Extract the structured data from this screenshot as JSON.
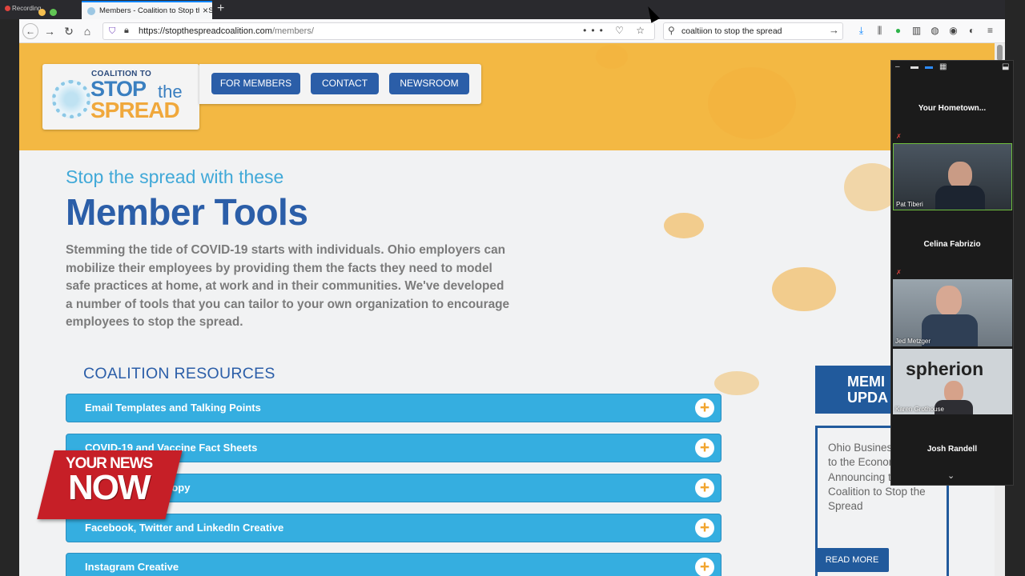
{
  "recording_label": "Recording",
  "browser": {
    "tab_title": "Members - Coalition to Stop the Spread",
    "tab_close": "×",
    "new_tab": "+",
    "url_domain": "https://stopthespreadcoalition.com",
    "url_path": "/members/",
    "search_value": "coaltiion to stop the spread",
    "icons": [
      "back-icon",
      "forward-icon",
      "reload-icon",
      "home-icon",
      "shield-icon",
      "lock-icon",
      "more-icon",
      "pocket-icon",
      "bookmark-star-icon",
      "search-icon",
      "arrow-right-icon",
      "download-icon",
      "library-icon",
      "extension-icon",
      "sidebar-icon",
      "extension-icon",
      "account-icon",
      "extension-icon",
      "menu-icon"
    ]
  },
  "site": {
    "logo": {
      "top": "COALITION TO",
      "stop": "STOP",
      "the": "the",
      "spread": "SPREAD"
    },
    "nav": [
      "FOR MEMBERS",
      "CONTACT",
      "NEWSROOM"
    ],
    "eyebrow": "Stop the spread with these",
    "title": "Member Tools",
    "intro": "Stemming the tide of COVID-19 starts with individuals. Ohio employers can mobilize their employees by providing them the facts they need to model safe practices at home, at work and in their communities. We've developed a number of tools that you can tailor to your own organization to encourage employees to stop the spread.",
    "resources_title": "COALITION RESOURCES",
    "resources": [
      "Email Templates and Talking Points",
      "COVID-19 and Vaccine Fact Sheets",
      "t Copy",
      "Facebook, Twitter and LinkedIn Creative",
      "Instagram Creative"
    ],
    "updates_header": "MEMI UPDA",
    "update_text": "Ohio Busines New Effort to the Economy Announcing the Coalition to Stop the Spread",
    "read_more": "READ MORE"
  },
  "news_bug": {
    "line1": "YOUR NEWS",
    "line2": "NOW"
  },
  "zoom": {
    "header": "Your Hometown...",
    "participants": [
      "Pat Tiberi",
      "Celina Fabrizio",
      "Jed Metzger",
      "Karen Grothouse",
      "Josh Randell"
    ],
    "spherion_logo": "spherion",
    "colors": {
      "panel": "#1b1b1b",
      "active_border": "#6fbf3f"
    }
  },
  "colors": {
    "hero": "#f3b843",
    "brand_blue": "#2b5ea8",
    "accordion": "#35aee0",
    "accent_orange": "#f2a52e",
    "news_red": "#c61f27"
  }
}
